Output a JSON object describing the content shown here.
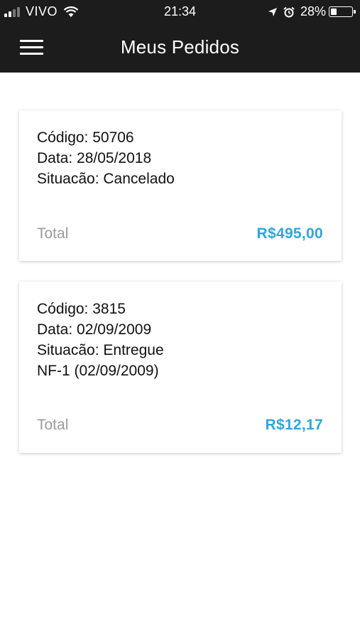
{
  "status_bar": {
    "carrier": "VIVO",
    "time": "21:34",
    "battery": "28%",
    "battery_level": 0.28
  },
  "header": {
    "title": "Meus Pedidos",
    "menu_icon": "hamburger-menu-icon"
  },
  "orders": [
    {
      "lines": [
        "Código: 50706",
        "Data: 28/05/2018",
        "Situacão: Cancelado"
      ],
      "total_label": "Total",
      "total_value": "R$495,00"
    },
    {
      "lines": [
        "Código: 3815",
        "Data: 02/09/2009",
        "Situacão: Entregue",
        "NF-1 (02/09/2009)"
      ],
      "total_label": "Total",
      "total_value": "R$12,17"
    }
  ],
  "colors": {
    "header_bg": "#1c1c1c",
    "accent": "#2ea6dd",
    "muted": "#9a9a9a"
  }
}
